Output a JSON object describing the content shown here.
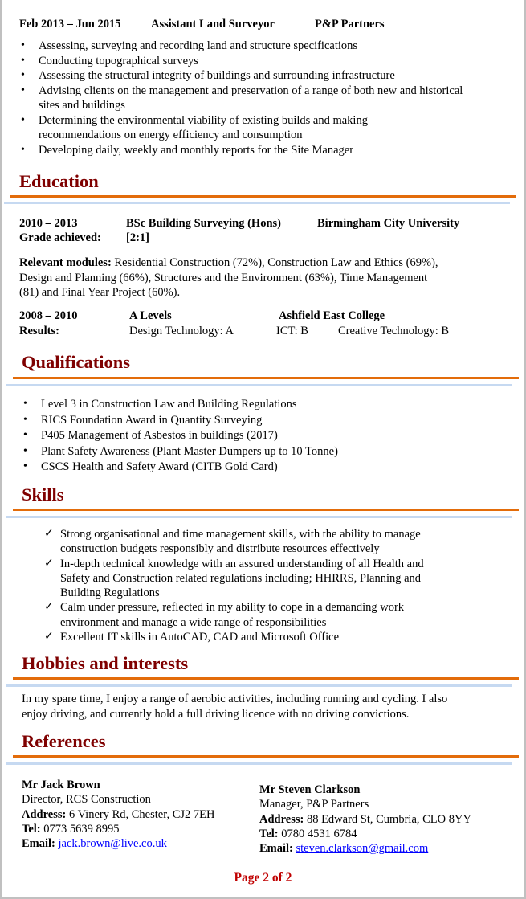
{
  "experience": {
    "dates": "Feb 2013 – Jun 2015",
    "title": "Assistant Land Surveyor",
    "company": "P&P Partners",
    "duties": [
      "Assessing, surveying and recording land and structure specifications",
      "Conducting topographical surveys",
      "Assessing the structural integrity of buildings and surrounding infrastructure",
      "Advising clients on the management and preservation of a range of both new and historical sites and buildings",
      "Determining the environmental viability of existing builds and making recommendations on energy efficiency and consumption",
      "Developing daily, weekly and monthly reports for the Site Manager"
    ]
  },
  "education": {
    "heading": "Education",
    "degree": {
      "dates": "2010 – 2013",
      "course": "BSc Building Surveying (Hons)",
      "institution": "Birmingham City University",
      "grade_label": "Grade achieved:",
      "grade": "[2:1]"
    },
    "modules_label": "Relevant modules:",
    "modules_text": " Residential Construction (72%), Construction Law and Ethics (69%), Design and Planning (66%), Structures and the Environment (63%), Time Management (81) and Final Year Project (60%).",
    "alevels": {
      "dates": "2008 – 2010",
      "course": "A Levels",
      "institution": "Ashfield East College",
      "results_label": "Results:",
      "result1": "Design Technology: A",
      "result2": "ICT: B",
      "result3": "Creative Technology: B"
    }
  },
  "qualifications": {
    "heading": "Qualifications",
    "items": [
      "Level 3 in Construction Law and Building Regulations",
      "RICS Foundation Award in Quantity Surveying",
      "P405 Management of Asbestos in buildings (2017)",
      "Plant Safety Awareness (Plant Master Dumpers up to 10 Tonne)",
      "CSCS Health and Safety Award (CITB Gold Card)"
    ]
  },
  "skills": {
    "heading": "Skills",
    "items": [
      "Strong organisational and time management skills, with the ability to manage construction budgets responsibly and distribute resources effectively",
      "In-depth technical knowledge with an assured understanding of all Health and Safety and Construction related regulations including; HHRRS, Planning and Building Regulations",
      "Calm under pressure, reflected in my ability to cope in a demanding work environment and manage a wide range of responsibilities",
      "Excellent IT skills in AutoCAD, CAD and Microsoft Office"
    ]
  },
  "hobbies": {
    "heading": "Hobbies and interests",
    "text": "In my spare time, I enjoy a range of aerobic activities, including running and cycling. I also enjoy driving, and currently hold a full driving licence with no driving convictions."
  },
  "references": {
    "heading": "References",
    "address_label": "Address:",
    "tel_label": "Tel:",
    "email_label": "Email:",
    "people": [
      {
        "name": "Mr Jack Brown",
        "role": "Director, RCS Construction",
        "address": " 6 Vinery Rd, Chester, CJ2 7EH",
        "tel": " 0773 5639 8995",
        "email": "jack.brown@live.co.uk"
      },
      {
        "name": "Mr Steven Clarkson",
        "role": "Manager, P&P Partners",
        "address": " 88 Edward St, Cumbria, CLO 8YY",
        "tel": " 0780 4531 6784",
        "email": "steven.clarkson@gmail.com"
      }
    ]
  },
  "footer": {
    "page": "Page 2 of 2"
  },
  "icons": {
    "bullet": "•",
    "check": "✓"
  },
  "colors": {
    "heading": "#7f0000",
    "rule_primary": "#e36c0a",
    "rule_secondary": "#c6d9f1",
    "link": "#0000ff",
    "footer": "#c00000"
  }
}
